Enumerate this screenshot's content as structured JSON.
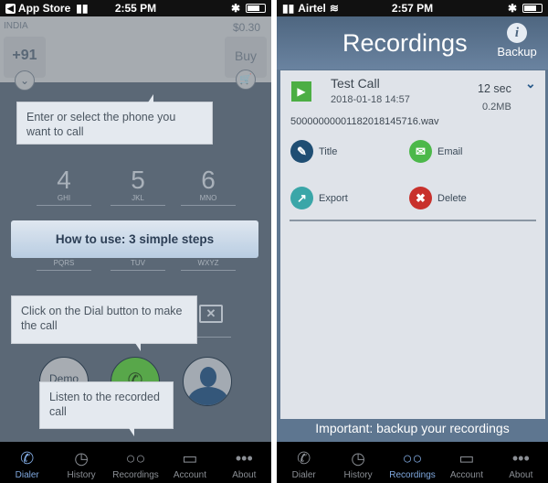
{
  "left": {
    "status": {
      "carrier": "App Store",
      "time": "2:55 PM"
    },
    "country": "INDIA",
    "balance": "$0.30",
    "country_code": "+91",
    "buy_label": "Buy",
    "tooltip_1": "Enter or select the phone you want to call",
    "keys": [
      {
        "digit": "4",
        "letters": "GHI"
      },
      {
        "digit": "5",
        "letters": "JKL"
      },
      {
        "digit": "6",
        "letters": "MNO"
      }
    ],
    "keys_row2_letters": [
      "PQRS",
      "TUV",
      "WXYZ"
    ],
    "how_to_label": "How to use: 3 simple steps",
    "tooltip_2": "Click on the Dial button to make the call",
    "demo_label": "Demo",
    "tooltip_3": "Listen to the recorded call",
    "tabs": [
      {
        "label": "Dialer",
        "icon": "phone-icon",
        "active": true
      },
      {
        "label": "History",
        "icon": "clock-icon"
      },
      {
        "label": "Recordings",
        "icon": "voicemail-icon"
      },
      {
        "label": "Account",
        "icon": "card-icon"
      },
      {
        "label": "About",
        "icon": "more-icon"
      }
    ]
  },
  "right": {
    "status": {
      "carrier": "Airtel",
      "time": "2:57 PM"
    },
    "title": "Recordings",
    "backup_label": "Backup",
    "recording": {
      "name": "Test Call",
      "datetime": "2018-01-18 14:57",
      "duration": "12 sec",
      "size": "0.2MB",
      "filename": "50000000001182018145716.wav"
    },
    "actions": [
      {
        "label": "Title",
        "color": "#1f4e73"
      },
      {
        "label": "Email",
        "color": "#4cb84a"
      },
      {
        "label": "Export",
        "color": "#3aa6a8"
      },
      {
        "label": "Delete",
        "color": "#c8312c"
      }
    ],
    "footer_notice": "Important: backup your recordings",
    "tabs": [
      {
        "label": "Dialer",
        "icon": "phone-icon"
      },
      {
        "label": "History",
        "icon": "clock-icon"
      },
      {
        "label": "Recordings",
        "icon": "voicemail-icon",
        "active": true
      },
      {
        "label": "Account",
        "icon": "card-icon"
      },
      {
        "label": "About",
        "icon": "more-icon"
      }
    ]
  }
}
